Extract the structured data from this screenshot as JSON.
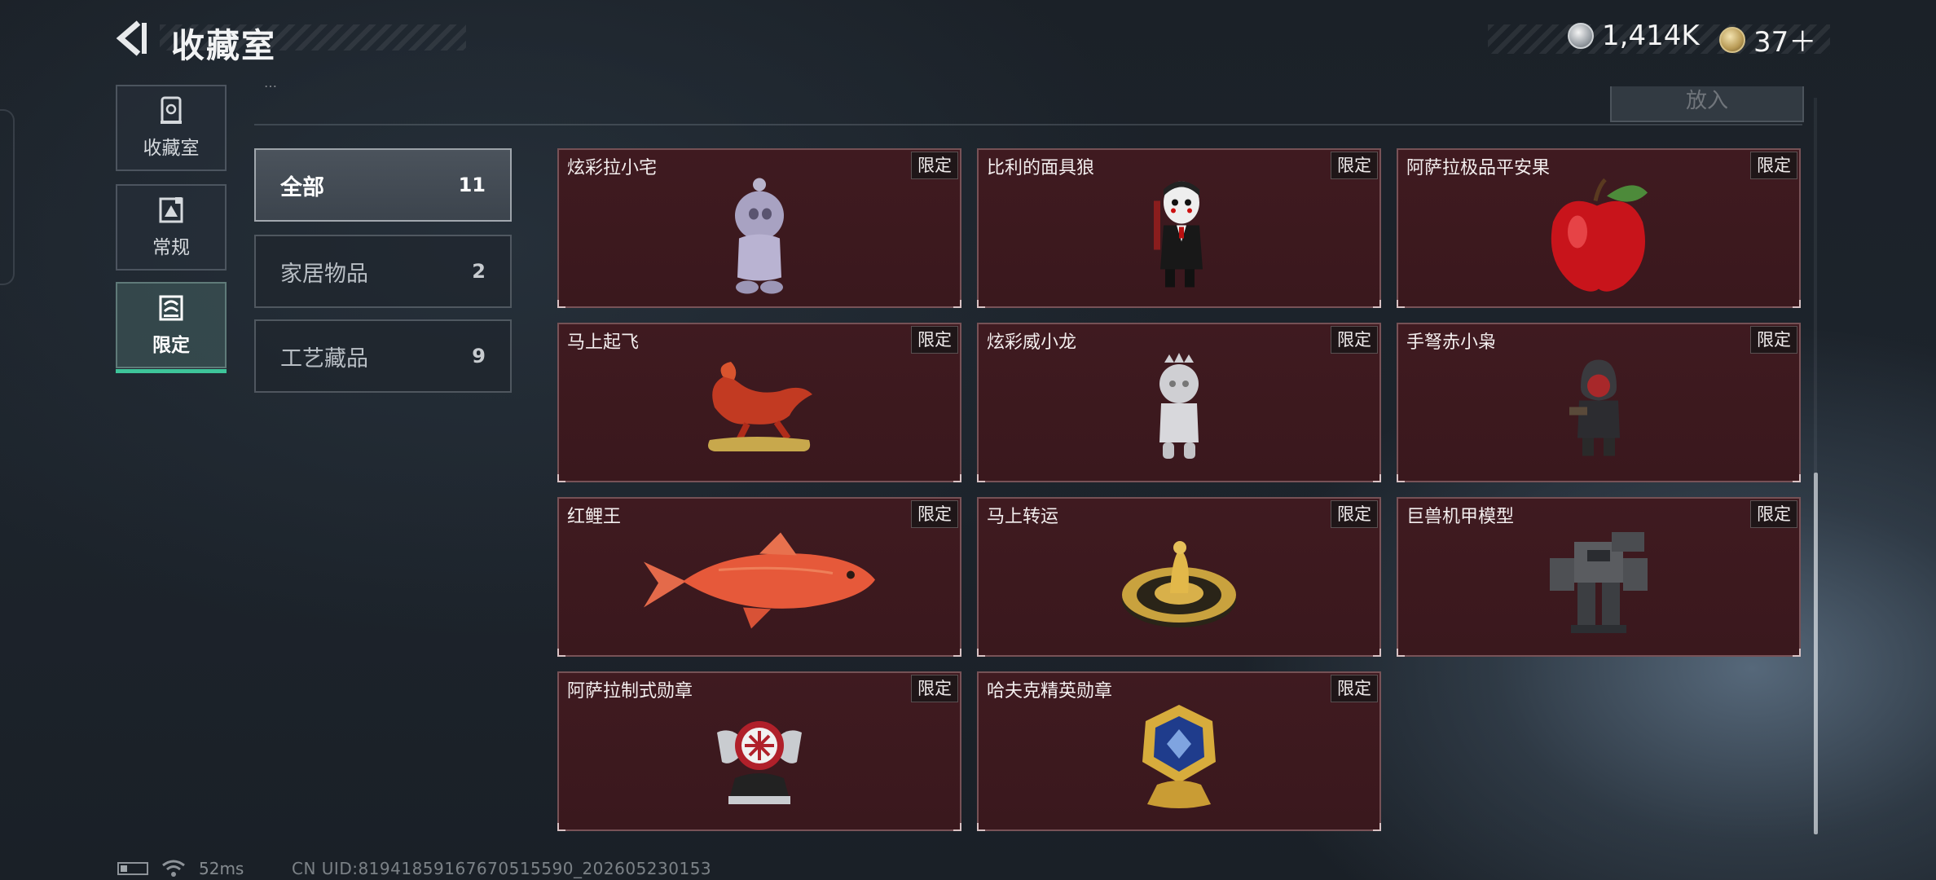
{
  "header": {
    "title": "收藏室",
    "currencies": [
      {
        "name": "silver-coin-icon",
        "value": "1,414K"
      },
      {
        "name": "gold-coin-icon",
        "value": "37＋"
      }
    ]
  },
  "nav": {
    "items": [
      {
        "label": "收藏室",
        "icon": "showcase-icon",
        "active": false
      },
      {
        "label": "常规",
        "icon": "regular-icon",
        "active": false
      },
      {
        "label": "限定",
        "icon": "limited-icon",
        "active": true
      }
    ]
  },
  "place_button": {
    "label": "放入"
  },
  "partial_text": "…",
  "categories": [
    {
      "name": "全部",
      "count": "11",
      "active": true
    },
    {
      "name": "家居物品",
      "count": "2",
      "active": false
    },
    {
      "name": "工艺藏品",
      "count": "9",
      "active": false
    }
  ],
  "items": [
    {
      "name": "炫彩拉小宅",
      "tag": "限定",
      "art": "doll-gray"
    },
    {
      "name": "比利的面具狼",
      "tag": "限定",
      "art": "billy-puppet"
    },
    {
      "name": "阿萨拉极品平安果",
      "tag": "限定",
      "art": "red-apple"
    },
    {
      "name": "马上起飞",
      "tag": "限定",
      "art": "red-horse"
    },
    {
      "name": "炫彩威小龙",
      "tag": "限定",
      "art": "doll-silver"
    },
    {
      "name": "手弩赤小枭",
      "tag": "限定",
      "art": "hooded-figure"
    },
    {
      "name": "红鲤王",
      "tag": "限定",
      "art": "red-carp"
    },
    {
      "name": "马上转运",
      "tag": "限定",
      "art": "gold-disc"
    },
    {
      "name": "巨兽机甲模型",
      "tag": "限定",
      "art": "mech-model"
    },
    {
      "name": "阿萨拉制式勋章",
      "tag": "限定",
      "art": "winged-medal"
    },
    {
      "name": "哈夫克精英勋章",
      "tag": "限定",
      "art": "gold-badge"
    }
  ],
  "status": {
    "ping": "52ms",
    "uid": "CN UID:81941859167670515590_202605230153"
  }
}
